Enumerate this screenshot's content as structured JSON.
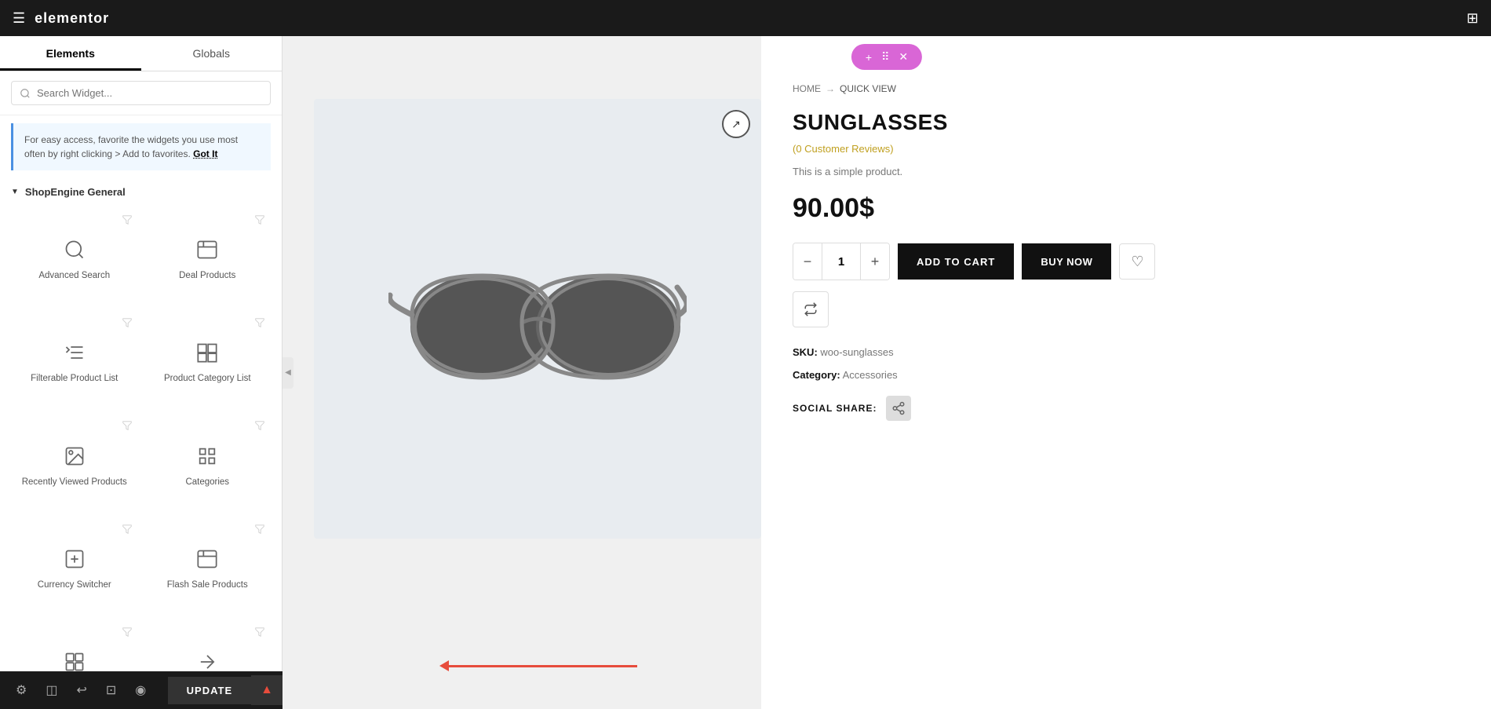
{
  "topbar": {
    "logo": "elementor",
    "hamburger_label": "☰",
    "grid_label": "⊞"
  },
  "sidebar": {
    "tab_elements": "Elements",
    "tab_globals": "Globals",
    "search_placeholder": "Search Widget...",
    "info_text": "For easy access, favorite the widgets you use most often by right clicking > Add to favorites.",
    "info_got_it": "Got It",
    "section_title": "ShopEngine General",
    "widgets": [
      {
        "id": "advanced-search",
        "label": "Advanced Search",
        "icon": "search"
      },
      {
        "id": "deal-products",
        "label": "Deal Products",
        "icon": "deal"
      },
      {
        "id": "filterable-product",
        "label": "Filterable Product List",
        "icon": "filter"
      },
      {
        "id": "product-category",
        "label": "Product Category List",
        "icon": "category"
      },
      {
        "id": "recently-viewed",
        "label": "Recently Viewed Products",
        "icon": "recent"
      },
      {
        "id": "categories",
        "label": "Categories",
        "icon": "tags"
      },
      {
        "id": "currency-switcher",
        "label": "Currency Switcher",
        "icon": "currency"
      },
      {
        "id": "flash-sale",
        "label": "Flash Sale Products",
        "icon": "flash"
      },
      {
        "id": "more1",
        "label": "",
        "icon": "more1"
      },
      {
        "id": "more2",
        "label": "",
        "icon": "more2"
      }
    ]
  },
  "bottom_toolbar": {
    "update_label": "UPDATE",
    "icons": [
      "⚙",
      "◫",
      "↩",
      "⊡",
      "◉"
    ]
  },
  "floating_toolbar": {
    "plus": "+",
    "dots": "⋯",
    "close": "✕"
  },
  "product": {
    "breadcrumb_home": "HOME",
    "breadcrumb_arrow": "→",
    "breadcrumb_current": "QUICK VIEW",
    "title": "SUNGLASSES",
    "reviews": "(0 Customer Reviews)",
    "description": "This is a simple product.",
    "price": "90.00$",
    "qty": "1",
    "add_to_cart": "ADD TO CART",
    "buy_now": "BUY NOW",
    "sku_label": "SKU:",
    "sku_value": "woo-sunglasses",
    "category_label": "Category:",
    "category_value": "Accessories",
    "social_label": "SOCIAL SHARE:"
  },
  "colors": {
    "accent_pink": "#d966d6",
    "black": "#111111",
    "red_arrow": "#e74c3c"
  }
}
